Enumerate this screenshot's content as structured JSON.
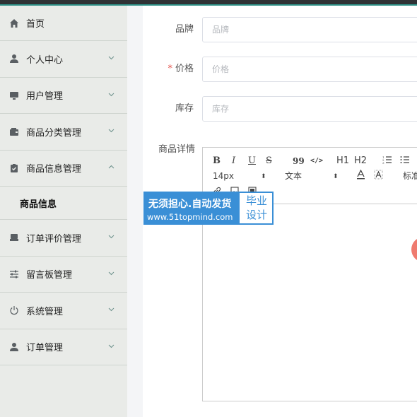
{
  "sidebar": {
    "items": [
      {
        "label": "首页",
        "icon": "home-icon",
        "has_chevron": false
      },
      {
        "label": "个人中心",
        "icon": "user-icon",
        "has_chevron": true
      },
      {
        "label": "用户管理",
        "icon": "monitor-icon",
        "has_chevron": true
      },
      {
        "label": "商品分类管理",
        "icon": "wallet-icon",
        "has_chevron": true
      },
      {
        "label": "商品信息管理",
        "icon": "clipboard-check-icon",
        "has_chevron": true,
        "expanded": true
      },
      {
        "label": "订单评价管理",
        "icon": "inbox-icon",
        "has_chevron": true
      },
      {
        "label": "留言板管理",
        "icon": "sliders-icon",
        "has_chevron": true
      },
      {
        "label": "系统管理",
        "icon": "power-icon",
        "has_chevron": true
      },
      {
        "label": "订单管理",
        "icon": "user-icon",
        "has_chevron": true
      }
    ],
    "submenu": {
      "label": "商品信息"
    }
  },
  "form": {
    "brand": {
      "label": "品牌",
      "placeholder": "品牌",
      "value": ""
    },
    "price": {
      "required_mark": "*",
      "label": "价格",
      "placeholder": "价格",
      "value": ""
    },
    "stock": {
      "label": "库存",
      "placeholder": "库存",
      "value": ""
    },
    "detail": {
      "label": "商品详情"
    }
  },
  "editor": {
    "toolbar": {
      "bold": "B",
      "italic": "I",
      "underline": "U",
      "strike": "S",
      "blockquote": "99",
      "code": "</>",
      "h1": "H1",
      "h2": "H2",
      "font_size": "14px",
      "text_type": "文本",
      "heading_cut": "标准"
    }
  },
  "watermark": {
    "line1": "无须担心.自动发货",
    "line2": "www.51topmind.com",
    "right_top": "毕业",
    "right_bottom": "设计"
  },
  "colors": {
    "accent": "#2e8f86",
    "topbar": "#2f3235",
    "sidebar_bg": "#e9ebe8",
    "required": "#e4534c",
    "watermark_blue": "#3a8fd6"
  }
}
